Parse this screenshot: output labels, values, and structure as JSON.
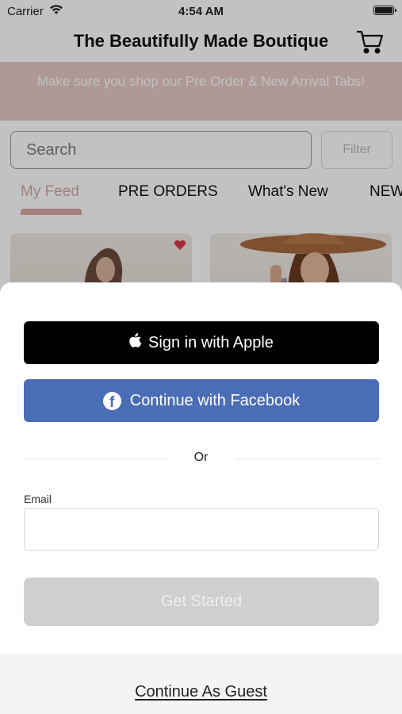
{
  "status_bar": {
    "carrier": "Carrier",
    "time": "4:54 AM"
  },
  "header": {
    "title": "The Beautifully Made Boutique",
    "cart_icon": "cart-icon"
  },
  "banner": {
    "text": "Make sure you shop our Pre Order & New Arrival Tabs!"
  },
  "search": {
    "placeholder": "Search",
    "filter_label": "Filter"
  },
  "tabs": [
    {
      "label": "My Feed",
      "active": true
    },
    {
      "label": "PRE ORDERS",
      "active": false
    },
    {
      "label": "What's New",
      "active": false
    },
    {
      "label": "NEW",
      "active": false
    }
  ],
  "colors": {
    "brand_pink": "#d9a8a4",
    "facebook_blue": "#4a6db6",
    "apple_black": "#000000",
    "disabled_gray": "#cfcfcf"
  },
  "sheet": {
    "apple_label": "Sign in with Apple",
    "facebook_label": "Continue with Facebook",
    "or_label": "Or",
    "email_label": "Email",
    "email_value": "",
    "get_started_label": "Get Started",
    "guest_label": "Continue As Guest"
  }
}
